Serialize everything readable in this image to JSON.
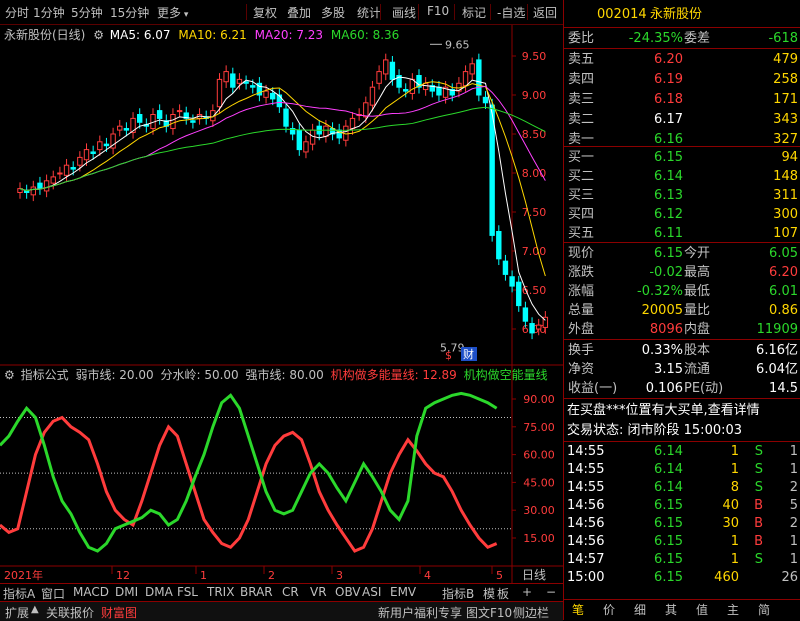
{
  "toolbar": {
    "items": [
      "分时",
      "1分钟",
      "5分钟",
      "15分钟",
      "更多",
      "复权",
      "叠加",
      "多股",
      "统计",
      "画线",
      "F10",
      "标记",
      "-自选",
      "返回"
    ]
  },
  "header": {
    "stock_name": "永新股份(日线)",
    "ma5_label": "MA5: 6.07",
    "ma10_label": "MA10: 6.21",
    "ma20_label": "MA20: 7.23",
    "ma60_label": "MA60: 8.36"
  },
  "price_axis": [
    "9.50",
    "9.00",
    "8.50",
    "8.00",
    "7.50",
    "7.00",
    "6.50",
    "6.00"
  ],
  "annotations": {
    "high": "9.65",
    "low": "5.79",
    "marker_s": "$",
    "marker_cai": "财"
  },
  "indicator": {
    "title": "指标公式",
    "weak": "弱市线: 20.00",
    "water": "分水岭: 50.00",
    "strong": "强市线: 80.00",
    "bull": "机构做多能量线: 12.89",
    "bear": "机构做空能量线"
  },
  "indicator_axis": [
    "90.00",
    "75.00",
    "60.00",
    "45.00",
    "30.00",
    "15.00"
  ],
  "date_axis": [
    "2021年",
    "12",
    "1",
    "2",
    "3",
    "4",
    "5"
  ],
  "bottom_tabs": [
    "指标A",
    "窗口",
    "MACD",
    "DMI",
    "DMA",
    "FSL",
    "TRIX",
    "BRAR",
    "CR",
    "VR",
    "OBV",
    "ASI",
    "EMV",
    "指标B",
    "模",
    "板",
    "+",
    "−"
  ],
  "bottom_right_label": "日线",
  "bottom_bar": [
    "扩展",
    "关联报价",
    "财富图",
    "新用户福利专享",
    "图文F10",
    "侧边栏"
  ],
  "quote": {
    "code": "002014",
    "name": "永新股份",
    "weibi_label": "委比",
    "weibi": "-24.35%",
    "weicha_label": "委差",
    "weicha": "-618",
    "asks": [
      {
        "label": "卖五",
        "price": "6.20",
        "vol": "479"
      },
      {
        "label": "卖四",
        "price": "6.19",
        "vol": "258"
      },
      {
        "label": "卖三",
        "price": "6.18",
        "vol": "171"
      },
      {
        "label": "卖二",
        "price": "6.17",
        "vol": "343"
      },
      {
        "label": "卖一",
        "price": "6.16",
        "vol": "327"
      }
    ],
    "bids": [
      {
        "label": "买一",
        "price": "6.15",
        "vol": "94"
      },
      {
        "label": "买二",
        "price": "6.14",
        "vol": "148"
      },
      {
        "label": "买三",
        "price": "6.13",
        "vol": "311"
      },
      {
        "label": "买四",
        "price": "6.12",
        "vol": "300"
      },
      {
        "label": "买五",
        "price": "6.11",
        "vol": "107"
      }
    ],
    "stats1": [
      {
        "l1": "现价",
        "v1": "6.15",
        "l2": "今开",
        "v2": "6.05"
      },
      {
        "l1": "涨跌",
        "v1": "-0.02",
        "l2": "最高",
        "v2": "6.20"
      },
      {
        "l1": "涨幅",
        "v1": "-0.32%",
        "l2": "最低",
        "v2": "6.01"
      },
      {
        "l1": "总量",
        "v1": "20005",
        "l2": "量比",
        "v2": "0.86"
      },
      {
        "l1": "外盘",
        "v1": "8096",
        "l2": "内盘",
        "v2": "11909"
      }
    ],
    "stats2": [
      {
        "l1": "换手",
        "v1": "0.33%",
        "l2": "股本",
        "v2": "6.16亿"
      },
      {
        "l1": "净资",
        "v1": "3.15",
        "l2": "流通",
        "v2": "6.04亿"
      },
      {
        "l1": "收益(一)",
        "v1": "0.106",
        "l2": "PE(动)",
        "v2": "14.5"
      }
    ],
    "notice": "在买盘***位置有大买单,查看详情",
    "status": "交易状态: 闭市阶段 15:00:03",
    "ticks": [
      {
        "t": "14:55",
        "p": "6.14",
        "v": "1",
        "d": "S",
        "n": "1"
      },
      {
        "t": "14:55",
        "p": "6.14",
        "v": "1",
        "d": "S",
        "n": "1"
      },
      {
        "t": "14:55",
        "p": "6.14",
        "v": "8",
        "d": "S",
        "n": "2"
      },
      {
        "t": "14:56",
        "p": "6.15",
        "v": "40",
        "d": "B",
        "n": "5"
      },
      {
        "t": "14:56",
        "p": "6.15",
        "v": "30",
        "d": "B",
        "n": "2"
      },
      {
        "t": "14:56",
        "p": "6.15",
        "v": "1",
        "d": "B",
        "n": "1"
      },
      {
        "t": "14:57",
        "p": "6.15",
        "v": "1",
        "d": "S",
        "n": "1"
      },
      {
        "t": "15:00",
        "p": "6.15",
        "v": "460",
        "d": "",
        "n": "26"
      }
    ],
    "footer_tabs": [
      "笔",
      "价",
      "细",
      "其",
      "值",
      "主",
      "简"
    ]
  },
  "colors": {
    "up": "#ff3c3c",
    "down": "#2bd82b",
    "ma5": "#ffffff",
    "ma10": "#ffd700",
    "ma20": "#ff40ff",
    "ma60": "#2bd82b",
    "grid": "#8b0000"
  }
}
